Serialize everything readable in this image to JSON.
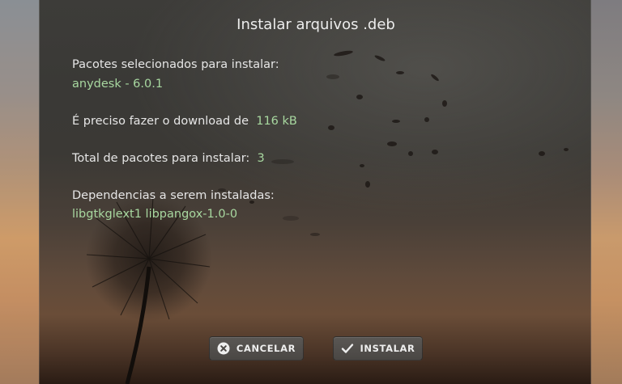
{
  "dialog": {
    "title": "Instalar arquivos .deb",
    "selected_label": "Pacotes selecionados para instalar:",
    "selected_value": "anydesk - 6.0.1",
    "download_label": "É preciso fazer o download de",
    "download_value": "116 kB",
    "total_label": "Total de pacotes para instalar:",
    "total_value": "3",
    "deps_label": "Dependencias a serem instaladas:",
    "deps_value": "libgtkglext1 libpangox-1.0-0"
  },
  "buttons": {
    "cancel_label": "CANCELAR",
    "cancel_icon": "close-circle-icon",
    "install_label": "INSTALAR",
    "install_icon": "checkmark-icon"
  }
}
